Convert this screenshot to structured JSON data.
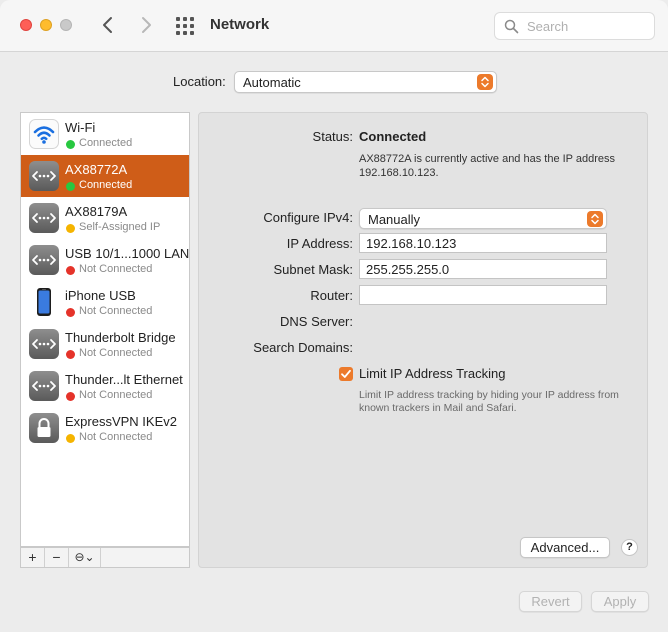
{
  "window": {
    "title": "Network",
    "search_placeholder": "Search"
  },
  "location": {
    "label": "Location:",
    "value": "Automatic"
  },
  "services": [
    {
      "name": "Wi-Fi",
      "status": "Connected",
      "status_color": "#28c840",
      "icon": "wifi-icon",
      "selected": false
    },
    {
      "name": "AX88772A",
      "status": "Connected",
      "status_color": "#28c840",
      "icon": "ethernet-icon",
      "selected": true
    },
    {
      "name": "AX88179A",
      "status": "Self-Assigned IP",
      "status_color": "#f5b400",
      "icon": "ethernet-icon",
      "selected": false
    },
    {
      "name": "USB 10/1...1000 LAN",
      "status": "Not Connected",
      "status_color": "#e5332a",
      "icon": "ethernet-icon",
      "selected": false
    },
    {
      "name": "iPhone USB",
      "status": "Not Connected",
      "status_color": "#e5332a",
      "icon": "iphone-icon",
      "selected": false
    },
    {
      "name": "Thunderbolt Bridge",
      "status": "Not Connected",
      "status_color": "#e5332a",
      "icon": "ethernet-icon",
      "selected": false
    },
    {
      "name": "Thunder...lt Ethernet",
      "status": "Not Connected",
      "status_color": "#e5332a",
      "icon": "ethernet-icon",
      "selected": false
    },
    {
      "name": "ExpressVPN IKEv2",
      "status": "Not Connected",
      "status_color": "#f5b400",
      "icon": "lock-icon",
      "selected": false
    }
  ],
  "sidebar_controls": {
    "add": "+",
    "remove": "−",
    "action": "⊖⌄"
  },
  "detail": {
    "status_label": "Status:",
    "status_value": "Connected",
    "status_description": "AX88772A is currently active and has the IP address 192.168.10.123.",
    "configure_label": "Configure IPv4:",
    "configure_value": "Manually",
    "ip_label": "IP Address:",
    "ip_value": "192.168.10.123",
    "subnet_label": "Subnet Mask:",
    "subnet_value": "255.255.255.0",
    "router_label": "Router:",
    "router_value": "",
    "dns_label": "DNS Server:",
    "search_domains_label": "Search Domains:",
    "limit_tracking_label": "Limit IP Address Tracking",
    "limit_tracking_checked": true,
    "limit_tracking_description": "Limit IP address tracking by hiding your IP address from known trackers in Mail and Safari.",
    "advanced_button": "Advanced...",
    "help_button": "?"
  },
  "footer": {
    "revert_button": "Revert",
    "apply_button": "Apply"
  },
  "colors": {
    "accent": "#ec7a2b",
    "selection": "#cf5d18"
  }
}
